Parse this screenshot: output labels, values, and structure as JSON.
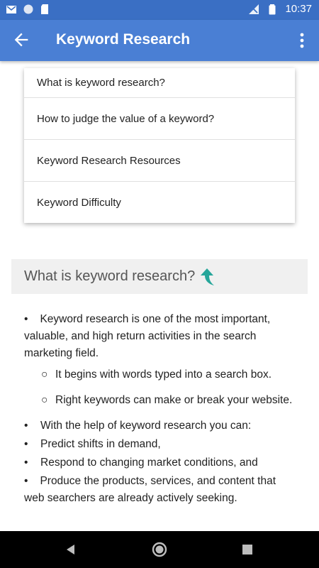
{
  "status_bar": {
    "time": "10:37",
    "icons": [
      "gmail-icon",
      "circle-icon",
      "sd-card-icon",
      "signal-off-icon",
      "battery-icon"
    ]
  },
  "app_bar": {
    "title": "Keyword Research",
    "back_icon": "arrow-left-icon",
    "menu_icon": "more-vert-icon"
  },
  "toc": {
    "items": [
      "What is keyword research?",
      "How to judge the value of a keyword?",
      "Keyword Research Resources",
      "Keyword Difficulty"
    ]
  },
  "section": {
    "title": "What is keyword research?",
    "up_icon": "arrow-up-icon"
  },
  "content": {
    "bullet_1": "Keyword research is one of the most important, valuable, and high return activities in the search marketing field.",
    "sub_1": "It begins with words typed into a search box.",
    "sub_2": "Right keywords can make or break your website.",
    "bullet_2": "With the help of keyword research you can:",
    "bullet_3": "Predict shifts in demand,",
    "bullet_4": "Respond to changing market conditions, and",
    "bullet_5": "Produce the products, services, and content that web searchers are already actively seeking.",
    "bullet_symbol": "•",
    "sub_symbol": "○"
  },
  "colors": {
    "status_bar": "#3a6fc4",
    "app_bar": "#4a7fd4",
    "accent_arrow": "#26a69a"
  }
}
